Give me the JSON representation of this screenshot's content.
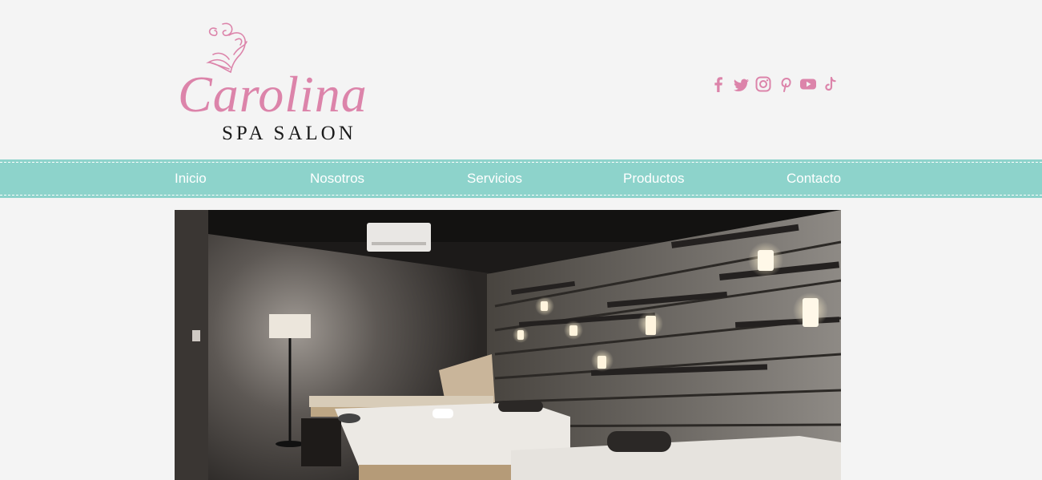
{
  "brand": {
    "name": "Carolina",
    "tagline": "SPA SALON",
    "color": "#dc84aa"
  },
  "social": [
    {
      "name": "facebook-icon"
    },
    {
      "name": "twitter-icon"
    },
    {
      "name": "instagram-icon"
    },
    {
      "name": "pinterest-icon"
    },
    {
      "name": "youtube-icon"
    },
    {
      "name": "tiktok-icon"
    }
  ],
  "nav": {
    "background": "#8dd3cb",
    "items": [
      {
        "label": "Inicio"
      },
      {
        "label": "Nosotros"
      },
      {
        "label": "Servicios"
      },
      {
        "label": "Productos"
      },
      {
        "label": "Contacto"
      }
    ]
  },
  "hero": {
    "subject": "spa treatment room photo"
  }
}
